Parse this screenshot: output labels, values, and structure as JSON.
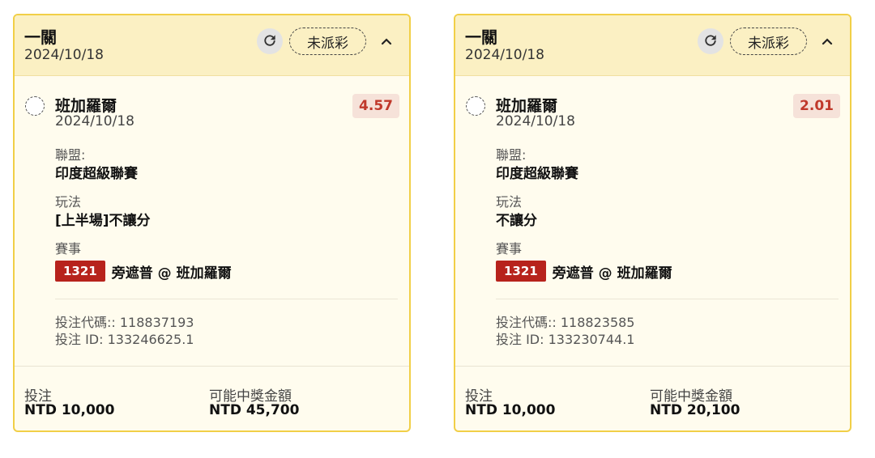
{
  "cards": [
    {
      "header_title": "一關",
      "header_date": "2024/10/18",
      "status_label": "未派彩",
      "team": "班加羅爾",
      "date": "2024/10/18",
      "odds": "4.57",
      "league_label": "聯盟:",
      "league_value": "印度超級聯賽",
      "bet_type_label": "玩法",
      "bet_type_value": "[上半場]不讓分",
      "event_label": "賽事",
      "event_id": "1321",
      "event_name": "旁遮普 @ 班加羅爾",
      "bet_code": "投注代碼:: 118837193",
      "bet_id": "投注 ID: 133246625.1",
      "stake_label": "投注",
      "stake_value": "NTD 10,000",
      "payout_label": "可能中獎金額",
      "payout_value": "NTD 45,700"
    },
    {
      "header_title": "一關",
      "header_date": "2024/10/18",
      "status_label": "未派彩",
      "team": "班加羅爾",
      "date": "2024/10/18",
      "odds": "2.01",
      "league_label": "聯盟:",
      "league_value": "印度超級聯賽",
      "bet_type_label": "玩法",
      "bet_type_value": "不讓分",
      "event_label": "賽事",
      "event_id": "1321",
      "event_name": "旁遮普 @ 班加羅爾",
      "bet_code": "投注代碼:: 118823585",
      "bet_id": "投注 ID: 133230744.1",
      "stake_label": "投注",
      "stake_value": "NTD 10,000",
      "payout_label": "可能中獎金額",
      "payout_value": "NTD 20,100"
    }
  ],
  "icons": {
    "refresh": "refresh-icon",
    "collapse": "chevron-up-icon",
    "radio": "radio-circle-icon"
  },
  "colors": {
    "card_border": "#f1cf47",
    "header_bg": "#fbf0c3",
    "card_bg": "#fffcee",
    "odds_text": "#c0392b",
    "event_id_bg": "#b7231c"
  }
}
